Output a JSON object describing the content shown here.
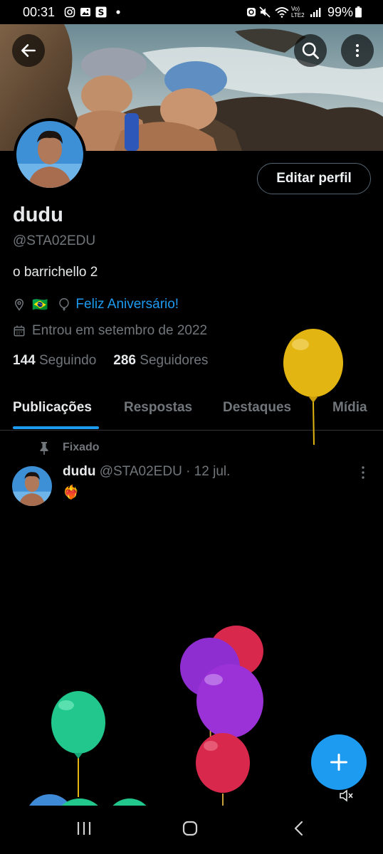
{
  "status_bar": {
    "time": "00:31",
    "battery": "99%",
    "network": "Vo) LTE2"
  },
  "profile": {
    "display_name": "dudu",
    "handle": "@STA02EDU",
    "bio": "o barrichello 2",
    "location_flag": "🇧🇷",
    "birthday_text": "Feliz Aniversário!",
    "joined": "Entrou em setembro de 2022",
    "following_count": "144",
    "following_label": "Seguindo",
    "followers_count": "286",
    "followers_label": "Seguidores",
    "edit_button": "Editar perfil"
  },
  "tabs": [
    {
      "label": "Publicações",
      "active": true
    },
    {
      "label": "Respostas",
      "active": false
    },
    {
      "label": "Destaques",
      "active": false
    },
    {
      "label": "Mídia",
      "active": false
    }
  ],
  "post": {
    "pinned_label": "Fixado",
    "author": "dudu",
    "meta": "@STA02EDU · 12 jul.",
    "content_emoji": "❤️‍🔥"
  },
  "icons": {
    "back": "arrow-left-icon",
    "search": "search-icon",
    "more": "more-vertical-icon",
    "location": "location-pin-icon",
    "birthday": "balloon-icon",
    "calendar": "calendar-icon",
    "pin": "pin-icon",
    "compose": "plus-icon",
    "mute": "speaker-muted-icon"
  },
  "colors": {
    "accent": "#1d9bf0",
    "background": "#000000",
    "secondary_text": "#71767b",
    "balloon_yellow": "#e2b512",
    "balloon_green": "#21c78d",
    "balloon_purple": "#9b32d8",
    "balloon_red": "#d8284c"
  }
}
